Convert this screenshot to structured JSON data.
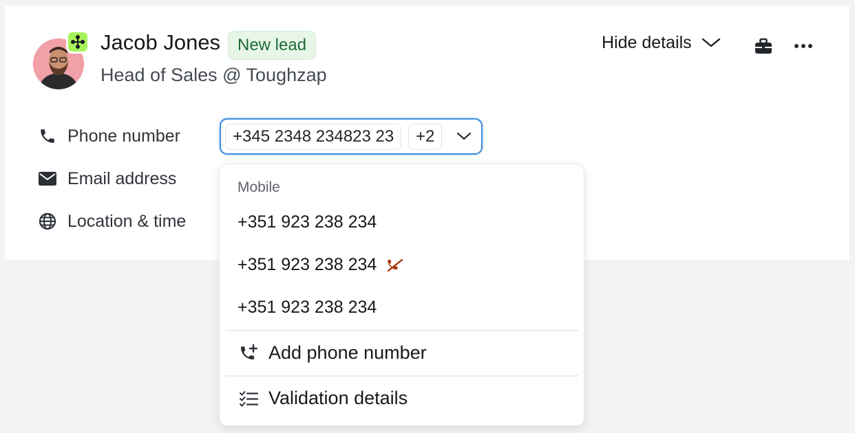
{
  "contact": {
    "name": "Jacob Jones",
    "status_badge": "New lead",
    "subtitle": "Head of Sales @ Toughzap"
  },
  "header": {
    "hide_details_label": "Hide details"
  },
  "fields": {
    "phone_label": "Phone number",
    "email_label": "Email address",
    "location_label": "Location & time"
  },
  "phone_select": {
    "selected_value": "+345 2348 234823 23",
    "extra_count": "+2"
  },
  "dropdown": {
    "section_label": "Mobile",
    "numbers": [
      "+351 923 238 234",
      "+351 923 238 234",
      "+351 923 238 234"
    ],
    "add_label": "Add phone number",
    "validation_label": "Validation details"
  },
  "colors": {
    "accent": "#3e8be0",
    "lead_badge_bg": "#e7f6e9",
    "lead_badge_text": "#1d6b35",
    "app_badge": "#a6f25a",
    "invalid_icon": "#a83a10"
  },
  "icons": [
    "app-logo-icon",
    "chevron-down-icon",
    "briefcase-icon",
    "more-horizontal-icon",
    "phone-icon",
    "mail-icon",
    "globe-icon",
    "phone-off-icon",
    "phone-plus-icon",
    "checklist-icon"
  ]
}
